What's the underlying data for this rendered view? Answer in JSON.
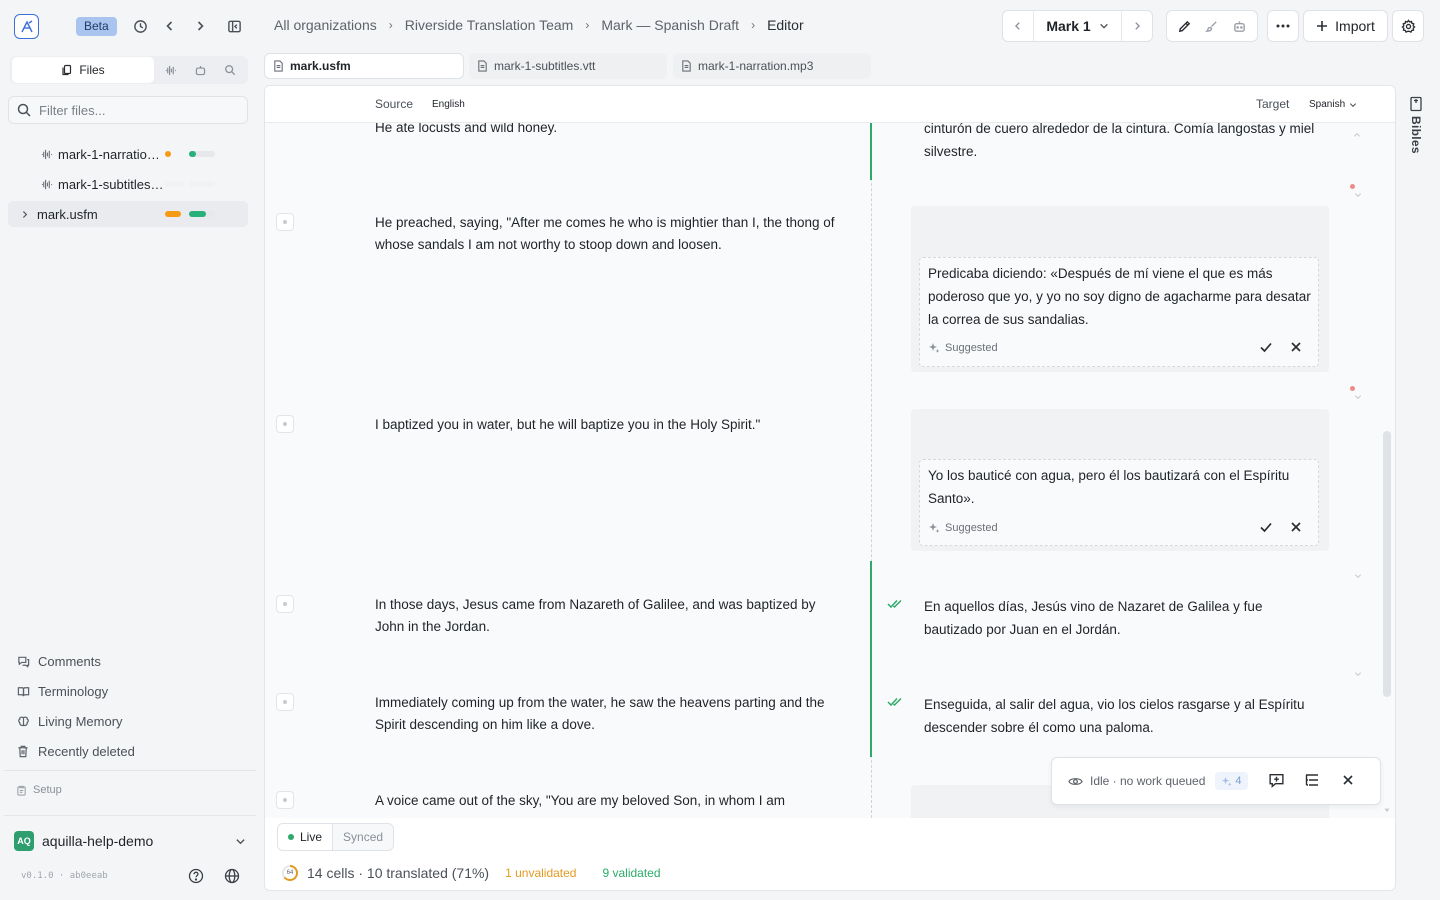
{
  "header": {
    "beta_label": "Beta",
    "breadcrumbs": [
      "All organizations",
      "Riverside Translation Team",
      "Mark — Spanish Draft",
      "Editor"
    ],
    "chapter": "Mark 1",
    "import_label": "Import"
  },
  "sidebar": {
    "files_tab": "Files",
    "filter_placeholder": "Filter files...",
    "files": [
      {
        "name": "mark-1-narratio…"
      },
      {
        "name": "mark-1-subtitles…"
      },
      {
        "name": "mark.usfm"
      }
    ],
    "nav": [
      "Comments",
      "Terminology",
      "Living Memory",
      "Recently deleted"
    ],
    "setup_label": "Setup",
    "workspace_initials": "AQ",
    "workspace_name": "aquilla-help-demo",
    "version": "v0.1.0 · ab0eeab"
  },
  "tabs": [
    "mark.usfm",
    "mark-1-subtitles.vtt",
    "mark-1-narration.mp3"
  ],
  "editor": {
    "source_label": "Source",
    "source_lang": "English",
    "target_label": "Target",
    "target_lang": "Spanish",
    "rows": [
      {
        "source": "He ate locusts and wild honey.",
        "target": "cinturón de cuero alrededor de la cintura. Comía langostas y miel silvestre."
      },
      {
        "source": "He preached, saying, \"After me comes he who is mightier than I, the thong of whose sandals I am not worthy to stoop down and loosen.",
        "suggestion": "Predicaba diciendo: «Después de mí viene el que es más poderoso que yo, y yo no soy digno de agacharme para desatar la correa de sus sandalias.",
        "suggested_label": "Suggested"
      },
      {
        "source": "I baptized you in water, but he will baptize you in the Holy Spirit.\"",
        "suggestion": "Yo los bauticé con agua, pero él los bautizará con el Espíritu Santo».",
        "suggested_label": "Suggested"
      },
      {
        "source": "In those days, Jesus came from Nazareth of Galilee, and was baptized by John in the Jordan.",
        "target": "En aquellos días, Jesús vino de Nazaret de Galilea y fue bautizado por Juan en el Jordán."
      },
      {
        "source": "Immediately coming up from the water, he saw the heavens parting and the Spirit descending on him like a dove.",
        "target": "Enseguida, al salir del agua, vio los cielos rasgarse y al Espíritu descender sobre él como una paloma."
      },
      {
        "source": "A voice came out of the sky, \"You are my beloved Son, in whom I am"
      }
    ],
    "status_text": "Idle · no work queued",
    "status_count": "4",
    "live_label": "Live",
    "synced_label": "Synced",
    "progress_number": "64",
    "progress_text": "14 cells · 10 translated (71%)",
    "unvalidated": "1 unvalidated",
    "validated": "9 validated"
  },
  "rail": {
    "bibles_label": "Bibles"
  },
  "colors": {
    "accent": "#3b6fd8",
    "validated": "#2eaa6a",
    "unvalidated": "#e39b1f",
    "workspace": "#2e9e6e"
  }
}
